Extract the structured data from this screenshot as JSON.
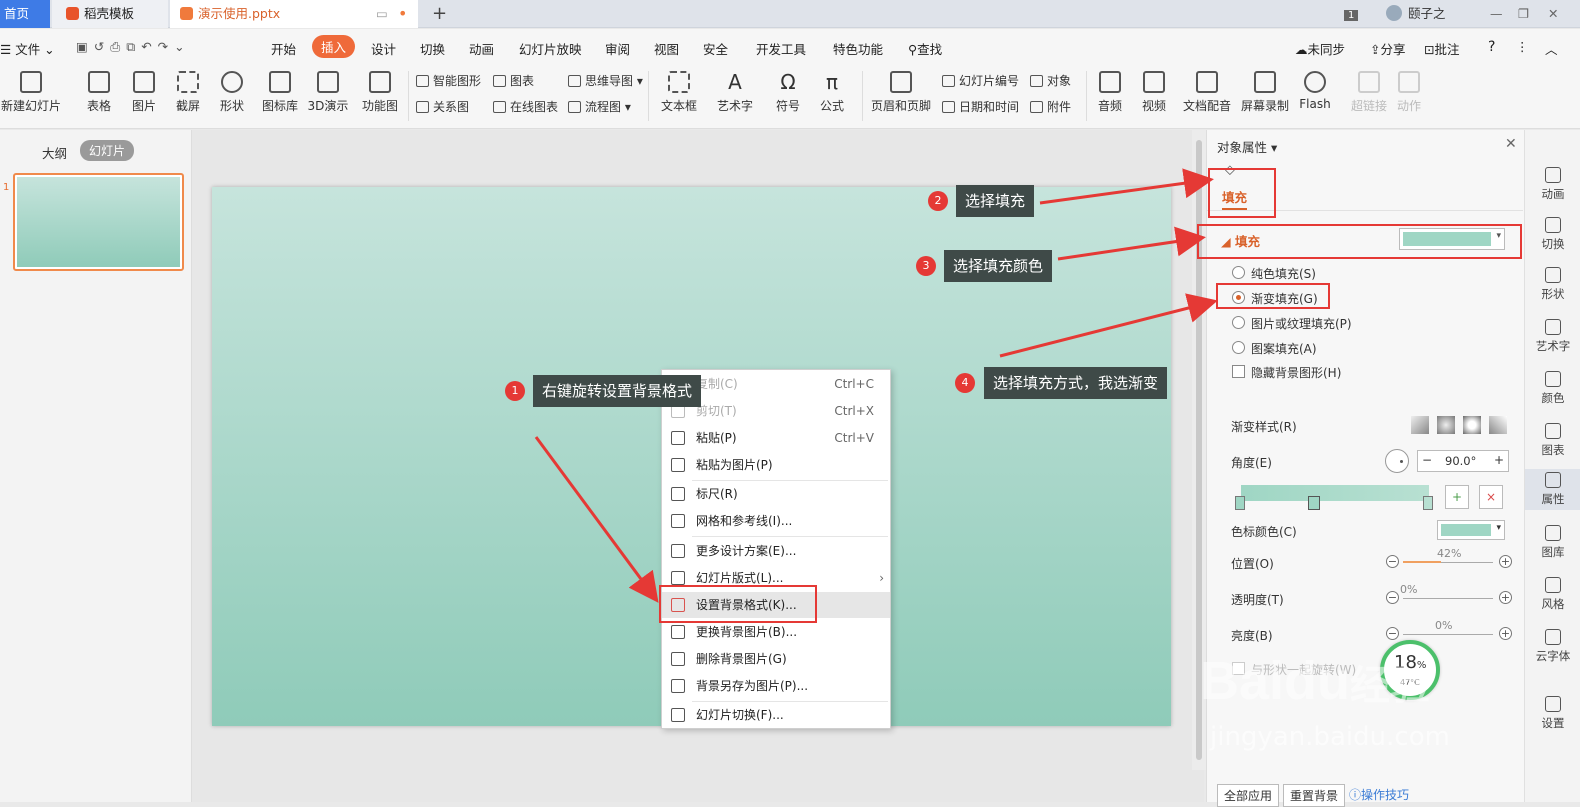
{
  "tabs": {
    "home": "首页",
    "template": "稻壳模板",
    "document": "演示使用.pptx"
  },
  "titlebar": {
    "page_badge": "1",
    "user": "颐子之"
  },
  "menubar": {
    "file": "文件",
    "items": [
      "开始",
      "插入",
      "设计",
      "切换",
      "动画",
      "幻灯片放映",
      "审阅",
      "视图",
      "安全",
      "开发工具",
      "特色功能"
    ],
    "search": "查找",
    "sync": "未同步",
    "share": "分享",
    "comment": "批注",
    "help": "?"
  },
  "ribbon": {
    "large": [
      "新建幻灯片",
      "表格",
      "图片",
      "截屏",
      "形状",
      "图标库",
      "3D演示",
      "功能图"
    ],
    "small": [
      "智能图形",
      "图表",
      "思维导图",
      "关系图",
      "在线图表",
      "流程图"
    ],
    "large2": [
      "文本框",
      "艺术字",
      "符号",
      "公式",
      "页眉和页脚"
    ],
    "small2": [
      "幻灯片编号",
      "对象",
      "日期和时间",
      "附件"
    ],
    "large3": [
      "音频",
      "视频",
      "文档配音",
      "屏幕录制",
      "Flash",
      "超链接",
      "动作"
    ]
  },
  "left_panel": {
    "outline_tab": "大纲",
    "slides_tab": "幻灯片",
    "slide_number": "1"
  },
  "context_menu": {
    "items": [
      {
        "label": "复制(C)",
        "shortcut": "Ctrl+C"
      },
      {
        "label": "剪切(T)",
        "shortcut": "Ctrl+X"
      },
      {
        "label": "粘贴(P)",
        "shortcut": "Ctrl+V"
      },
      {
        "label": "粘贴为图片(P)",
        "shortcut": ""
      },
      {
        "label": "标尺(R)",
        "shortcut": ""
      },
      {
        "label": "网格和参考线(I)...",
        "shortcut": ""
      },
      {
        "label": "更多设计方案(E)...",
        "shortcut": ""
      },
      {
        "label": "幻灯片版式(L)...",
        "shortcut": "›"
      },
      {
        "label": "设置背景格式(K)...",
        "shortcut": ""
      },
      {
        "label": "更换背景图片(B)...",
        "shortcut": ""
      },
      {
        "label": "删除背景图片(G)",
        "shortcut": ""
      },
      {
        "label": "背景另存为图片(P)...",
        "shortcut": ""
      },
      {
        "label": "幻灯片切换(F)...",
        "shortcut": ""
      }
    ]
  },
  "callouts": [
    {
      "n": "1",
      "text": "右键旋转设置背景格式"
    },
    {
      "n": "2",
      "text": "选择填充"
    },
    {
      "n": "3",
      "text": "选择填充颜色"
    },
    {
      "n": "4",
      "text": "选择填充方式，我选渐变"
    }
  ],
  "right_panel": {
    "title": "对象属性",
    "fill_tab": "填充",
    "fill_section": "填充",
    "options": [
      "纯色填充(S)",
      "渐变填充(G)",
      "图片或纹理填充(P)",
      "图案填充(A)"
    ],
    "hide_bg": "隐藏背景图形(H)",
    "gradient_style": "渐变样式(R)",
    "angle_label": "角度(E)",
    "angle_value": "90.0°",
    "color_stop": "色标颜色(C)",
    "position": "位置(O)",
    "position_value": "42%",
    "position_level": 0.42,
    "transparency": "透明度(T)",
    "transparency_value": "0%",
    "brightness": "亮度(B)",
    "brightness_value": "0%",
    "rotate_with_shape": "与形状一起旋转(W)",
    "apply_all": "全部应用",
    "reset_bg": "重置背景",
    "tips": "操作技巧",
    "fill_color": "#9fd6c4"
  },
  "right_rail": [
    "动画",
    "切换",
    "形状",
    "艺术字",
    "颜色",
    "图表",
    "属性",
    "图库",
    "风格",
    "云字体",
    "设置"
  ],
  "badge": {
    "percent": "18",
    "percent_sign": "%",
    "temp": "47°C"
  },
  "watermark": {
    "brand": "Baidu",
    "sub": "经验",
    "url": "jingyan.baidu.com"
  }
}
